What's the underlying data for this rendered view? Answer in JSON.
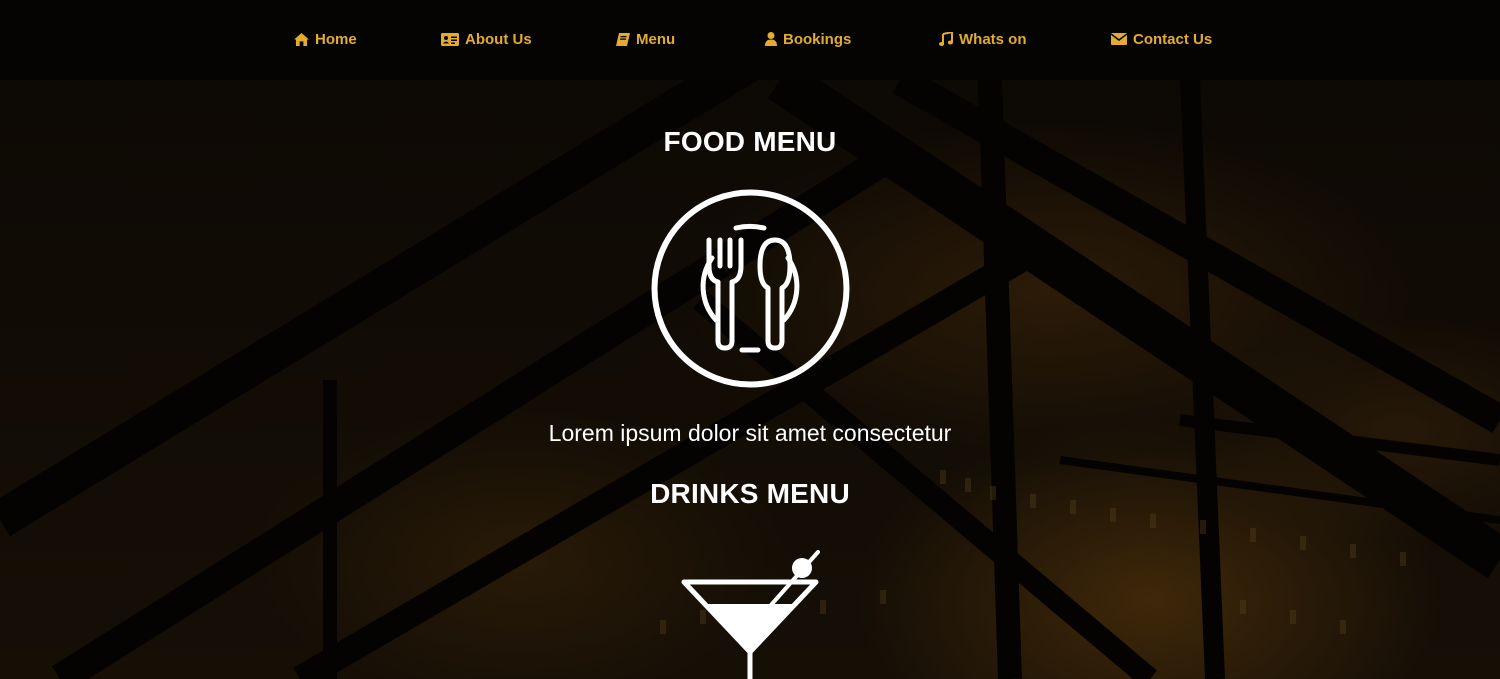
{
  "nav": {
    "items": [
      {
        "label": "Home",
        "icon": "home-icon"
      },
      {
        "label": "About Us",
        "icon": "id-card-icon"
      },
      {
        "label": "Menu",
        "icon": "book-icon"
      },
      {
        "label": "Bookings",
        "icon": "user-icon"
      },
      {
        "label": "Whats on",
        "icon": "music-icon"
      },
      {
        "label": "Contact Us",
        "icon": "envelope-icon"
      }
    ]
  },
  "food_menu": {
    "title": "FOOD MENU",
    "icon": "plate-fork-spoon-icon",
    "description": "Lorem ipsum dolor sit amet consectetur"
  },
  "drinks_menu": {
    "title": "DRINKS MENU",
    "icon": "cocktail-glass-icon"
  },
  "colors": {
    "accent": "#e2ac33",
    "nav_background": "#050403",
    "text": "#ffffff"
  }
}
